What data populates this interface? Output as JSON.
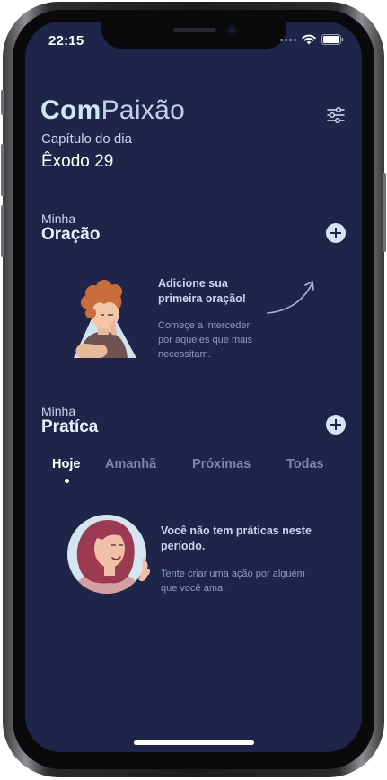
{
  "status_bar": {
    "time": "22:15"
  },
  "header": {
    "logo_bold": "Com",
    "logo_light": "Paixão",
    "chapter_label": "Capítulo do dia",
    "chapter_value": "Êxodo 29"
  },
  "prayer": {
    "small_label": "Minha",
    "title": "Oração",
    "empty_title_line1": "Adicione sua",
    "empty_title_line2": "primeira oração!",
    "empty_desc_line1": "Começe a interceder",
    "empty_desc_line2": "por aqueles que mais",
    "empty_desc_line3": "necessitam."
  },
  "practice": {
    "small_label": "Minha",
    "title": "Pratíca",
    "tabs": [
      {
        "label": "Hoje",
        "active": true
      },
      {
        "label": "Amanhã",
        "active": false
      },
      {
        "label": "Próximas",
        "active": false
      },
      {
        "label": "Todas",
        "active": false
      }
    ],
    "empty_title_line1": "Você não tem práticas neste",
    "empty_title_line2": "período.",
    "empty_desc_line1": "Tente criar uma ação por alguém",
    "empty_desc_line2": "que você ama."
  },
  "icons": {
    "filter": "sliders-icon",
    "add": "plus-circle-icon",
    "arrow": "curved-arrow-icon",
    "wifi": "wifi-icon",
    "battery": "battery-icon"
  },
  "colors": {
    "background": "#1f2549",
    "accent": "#d6e4f2",
    "muted_text": "#8e9ac0",
    "inactive_tab": "#7d85a8"
  }
}
